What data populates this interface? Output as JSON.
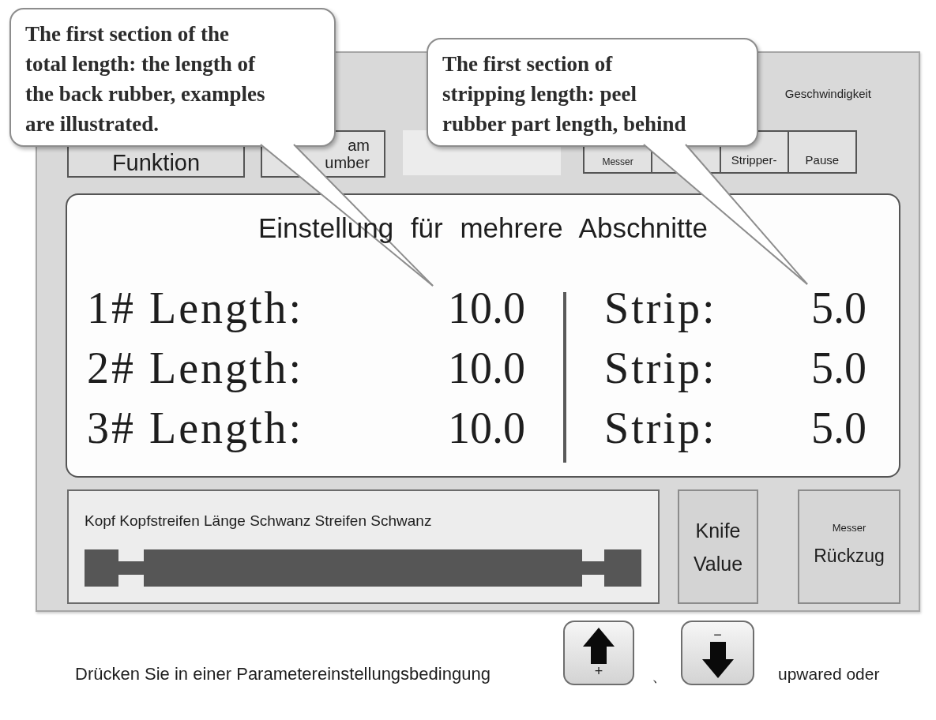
{
  "callouts": [
    {
      "text": "The first section of the\ntotal length: the length of\nthe back rubber, examples\nare illustrated."
    },
    {
      "text": "The first section of\nstripping length: peel\nrubber part length, behind"
    }
  ],
  "toolbar": {
    "speed_label": "Geschwindigkeit",
    "function_button": "Funktion",
    "program_button": "am\number",
    "mode_buttons": [
      {
        "kind": "small",
        "label": "Messer"
      },
      {
        "kind": "blank"
      },
      {
        "kind": "normal",
        "label": "Stripper-"
      },
      {
        "kind": "normal",
        "label": "Pause"
      }
    ]
  },
  "settings_panel": {
    "title": "Einstellung für mehrere Abschnitte",
    "rows": [
      {
        "length_label": "1# Length:",
        "length_value": "10.0",
        "strip_label": "Strip:",
        "strip_value": "5.0"
      },
      {
        "length_label": "2# Length:",
        "length_value": "10.0",
        "strip_label": "Strip:",
        "strip_value": "5.0"
      },
      {
        "length_label": "3# Length:",
        "length_value": "10.0",
        "strip_label": "Strip:",
        "strip_value": "5.0"
      }
    ]
  },
  "diagram": {
    "caption": "Kopf Kopfstreifen Länge Schwanz Streifen Schwanz"
  },
  "side_buttons": [
    {
      "kind": "single",
      "label": "Knife\nValue"
    },
    {
      "kind": "stacked",
      "small_label": "Messer",
      "label": "Rückzug"
    }
  ],
  "footer": {
    "text": "Drücken Sie in einer Parametereinstellungsbedingung",
    "keys": [
      {
        "kind": "up",
        "sign": "+"
      },
      {
        "kind": "down",
        "sign": "−"
      }
    ],
    "separator": "、",
    "trailing_text": "upwared oder"
  }
}
